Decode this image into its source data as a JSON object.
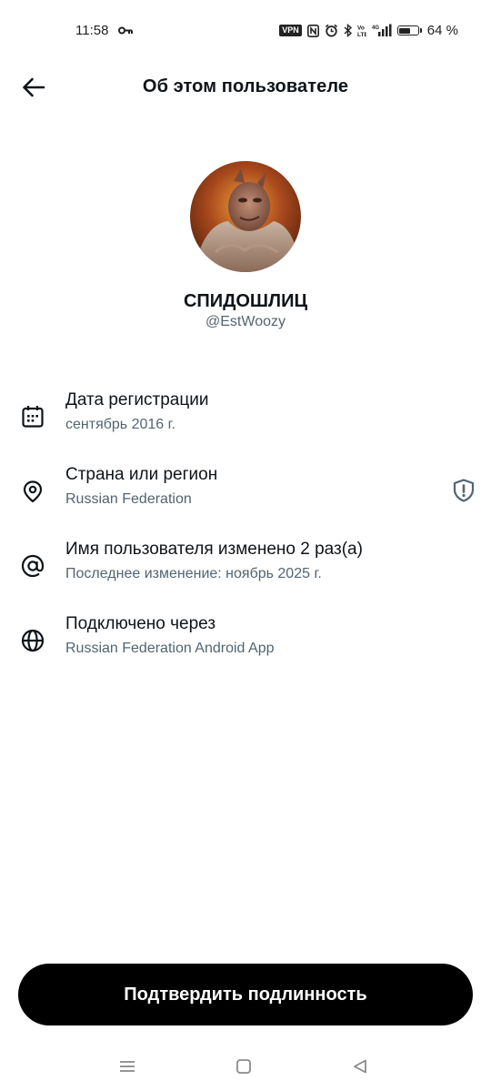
{
  "status_bar": {
    "time": "11:58",
    "vpn": "VPN",
    "battery_percent": "64 %",
    "battery_level": 0.64,
    "icons": [
      "key-icon",
      "vpn-icon",
      "nfc-icon",
      "alarm-icon",
      "bluetooth-icon",
      "volte-icon",
      "signal-icon",
      "battery-icon"
    ]
  },
  "header": {
    "title": "Об этом пользователе",
    "back_icon": "arrow-left-icon"
  },
  "profile": {
    "display_name": "СПИДОШЛИЦ",
    "handle": "@EstWoozy"
  },
  "info": [
    {
      "icon": "calendar-icon",
      "title": "Дата регистрации",
      "subtitle": "сентябрь 2016 г."
    },
    {
      "icon": "location-pin-icon",
      "title": "Страна или регион",
      "subtitle": "Russian Federation",
      "trailing_icon": "shield-exclamation-icon"
    },
    {
      "icon": "at-sign-icon",
      "title": "Имя пользователя изменено 2 раз(а)",
      "subtitle": "Последнее изменение: ноябрь 2025 г."
    },
    {
      "icon": "globe-icon",
      "title": "Подключено через",
      "subtitle": "Russian Federation Android App"
    }
  ],
  "verify_button": {
    "label": "Подтвердить подлинность"
  },
  "nav_bar": {
    "icons": [
      "menu-icon",
      "home-square-icon",
      "back-triangle-icon"
    ]
  },
  "colors": {
    "primary_text": "#0f1419",
    "secondary_text": "#536471",
    "button_bg": "#000000",
    "button_text": "#ffffff"
  }
}
